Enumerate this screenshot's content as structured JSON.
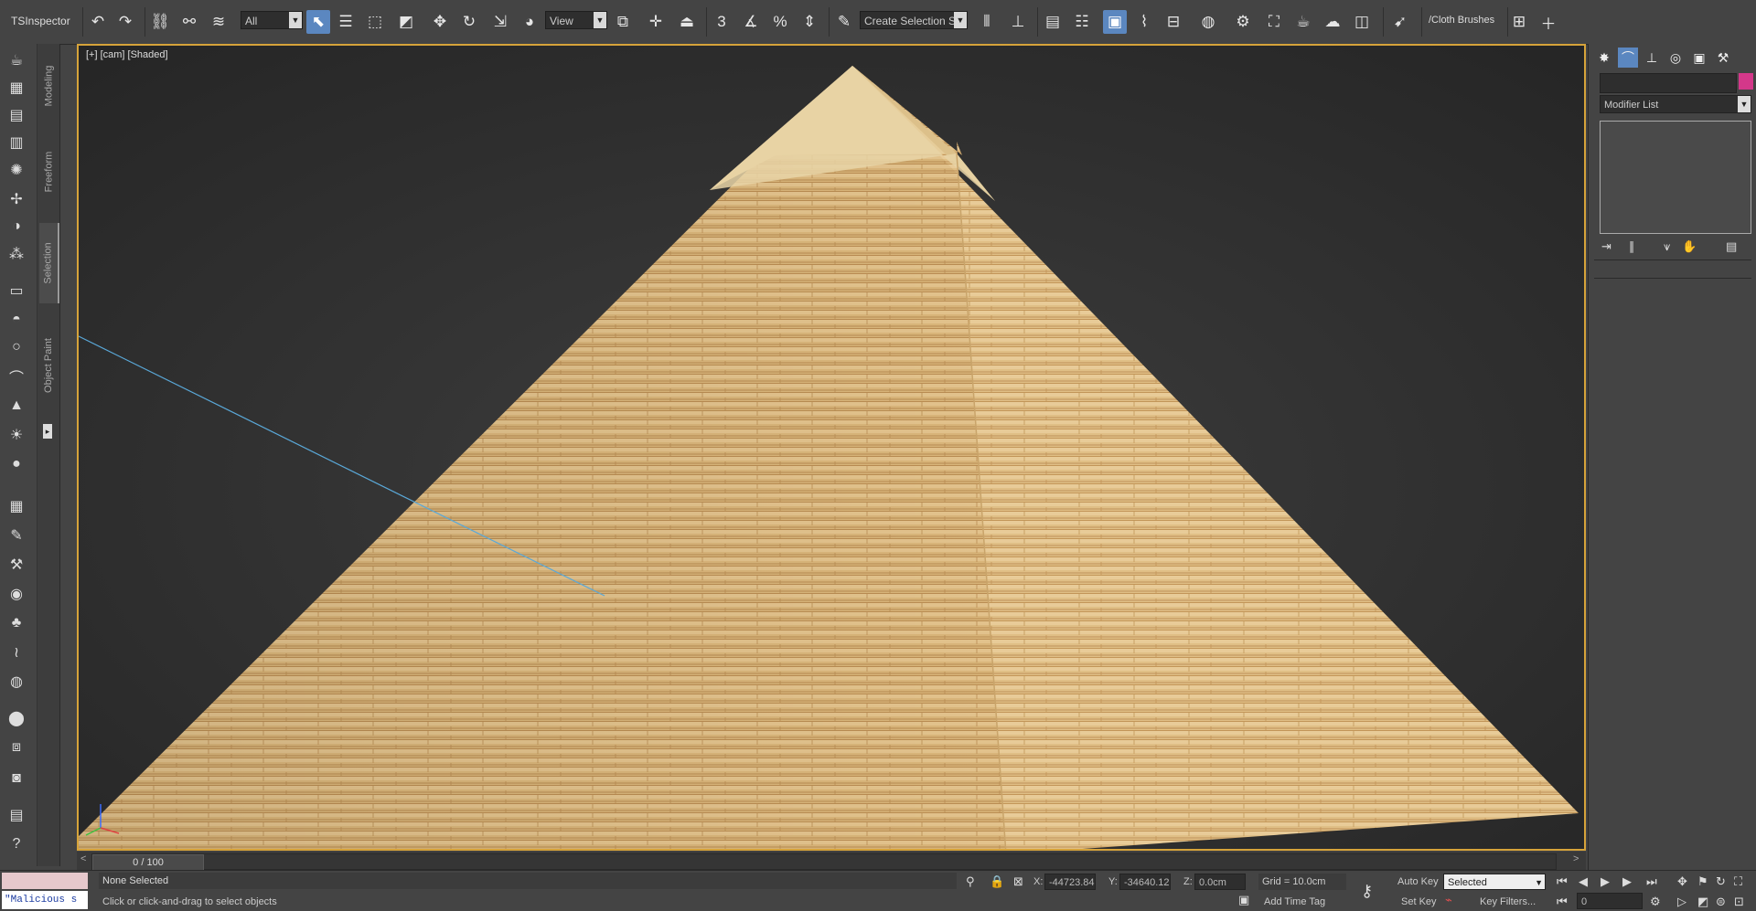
{
  "toolbar": {
    "workspace_label": "TSInspector",
    "selection_filter": "All",
    "ref_coord": "View",
    "named_selection": "Create Selection Se",
    "cloth_label": "/Cloth Brushes",
    "snap_3_label": "3",
    "percent_snap_label": "%"
  },
  "ribbon_tabs": [
    "Modeling",
    "Freeform",
    "Selection",
    "Object Paint"
  ],
  "viewport": {
    "label": "[+] [cam] [Shaded]"
  },
  "timeslider": {
    "position": "0 / 100",
    "prev": "<",
    "next": ">"
  },
  "status": {
    "maxscript_text": "\"Malicious s",
    "selection_text": "None Selected",
    "prompt_text": "Click or click-and-drag to select objects",
    "x_label": "X:",
    "x_value": "-44723.84",
    "y_label": "Y:",
    "y_value": "-34640.12",
    "z_label": "Z:",
    "z_value": "0.0cm",
    "grid": "Grid = 10.0cm",
    "add_time_tag": "Add Time Tag",
    "auto_key": "Auto Key",
    "set_key": "Set Key",
    "key_mode": "Selected",
    "key_filters": "Key Filters...",
    "frame": "0"
  },
  "command_panel": {
    "modifier_list": "Modifier List",
    "object_color": "#d4388a"
  },
  "colors": {
    "accent": "#5b87c0",
    "viewport_border": "#d6a33a",
    "ui_bg": "#444444"
  }
}
